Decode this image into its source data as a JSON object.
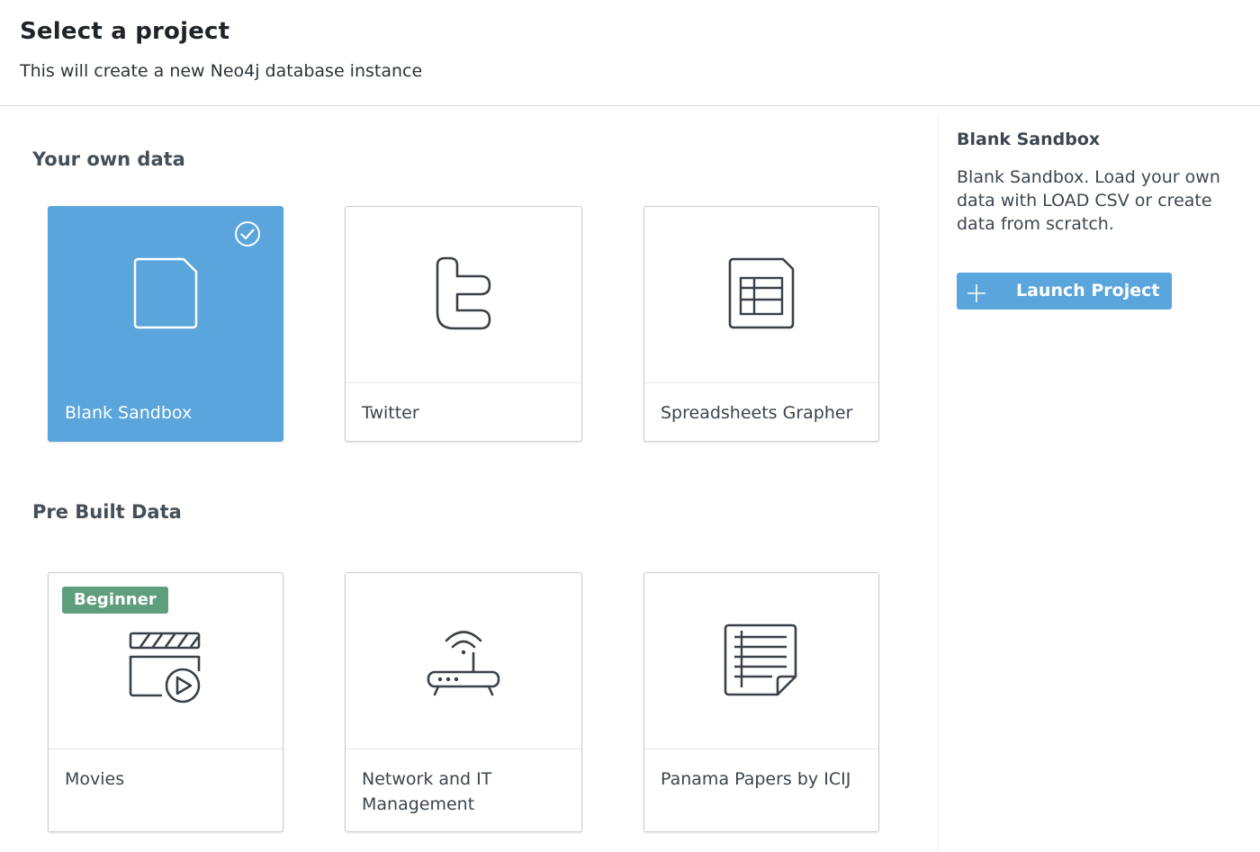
{
  "header": {
    "title": "Select a project",
    "subtitle": "This will create a new Neo4j database instance"
  },
  "sections": {
    "own_data": {
      "title": "Your own data",
      "cards": [
        {
          "label": "Blank Sandbox",
          "icon": "blank-file-icon",
          "selected": true
        },
        {
          "label": "Twitter",
          "icon": "twitter-icon",
          "selected": false
        },
        {
          "label": "Spreadsheets Grapher",
          "icon": "spreadsheet-icon",
          "selected": false
        }
      ]
    },
    "prebuilt": {
      "title": "Pre Built Data",
      "cards": [
        {
          "label": "Movies",
          "icon": "movie-clapper-icon",
          "badge": "Beginner"
        },
        {
          "label": "Network and IT Management",
          "icon": "router-icon"
        },
        {
          "label": "Panama Papers by ICIJ",
          "icon": "document-list-icon"
        }
      ]
    }
  },
  "detail": {
    "title": "Blank Sandbox",
    "description": "Blank Sandbox. Load your own data with LOAD CSV or create data from scratch.",
    "launch_label": "Launch Project"
  },
  "colors": {
    "accent": "#5aa5dc",
    "badge": "#5e9e7c",
    "text": "#2b3440",
    "icon_stroke": "#3a4148"
  }
}
